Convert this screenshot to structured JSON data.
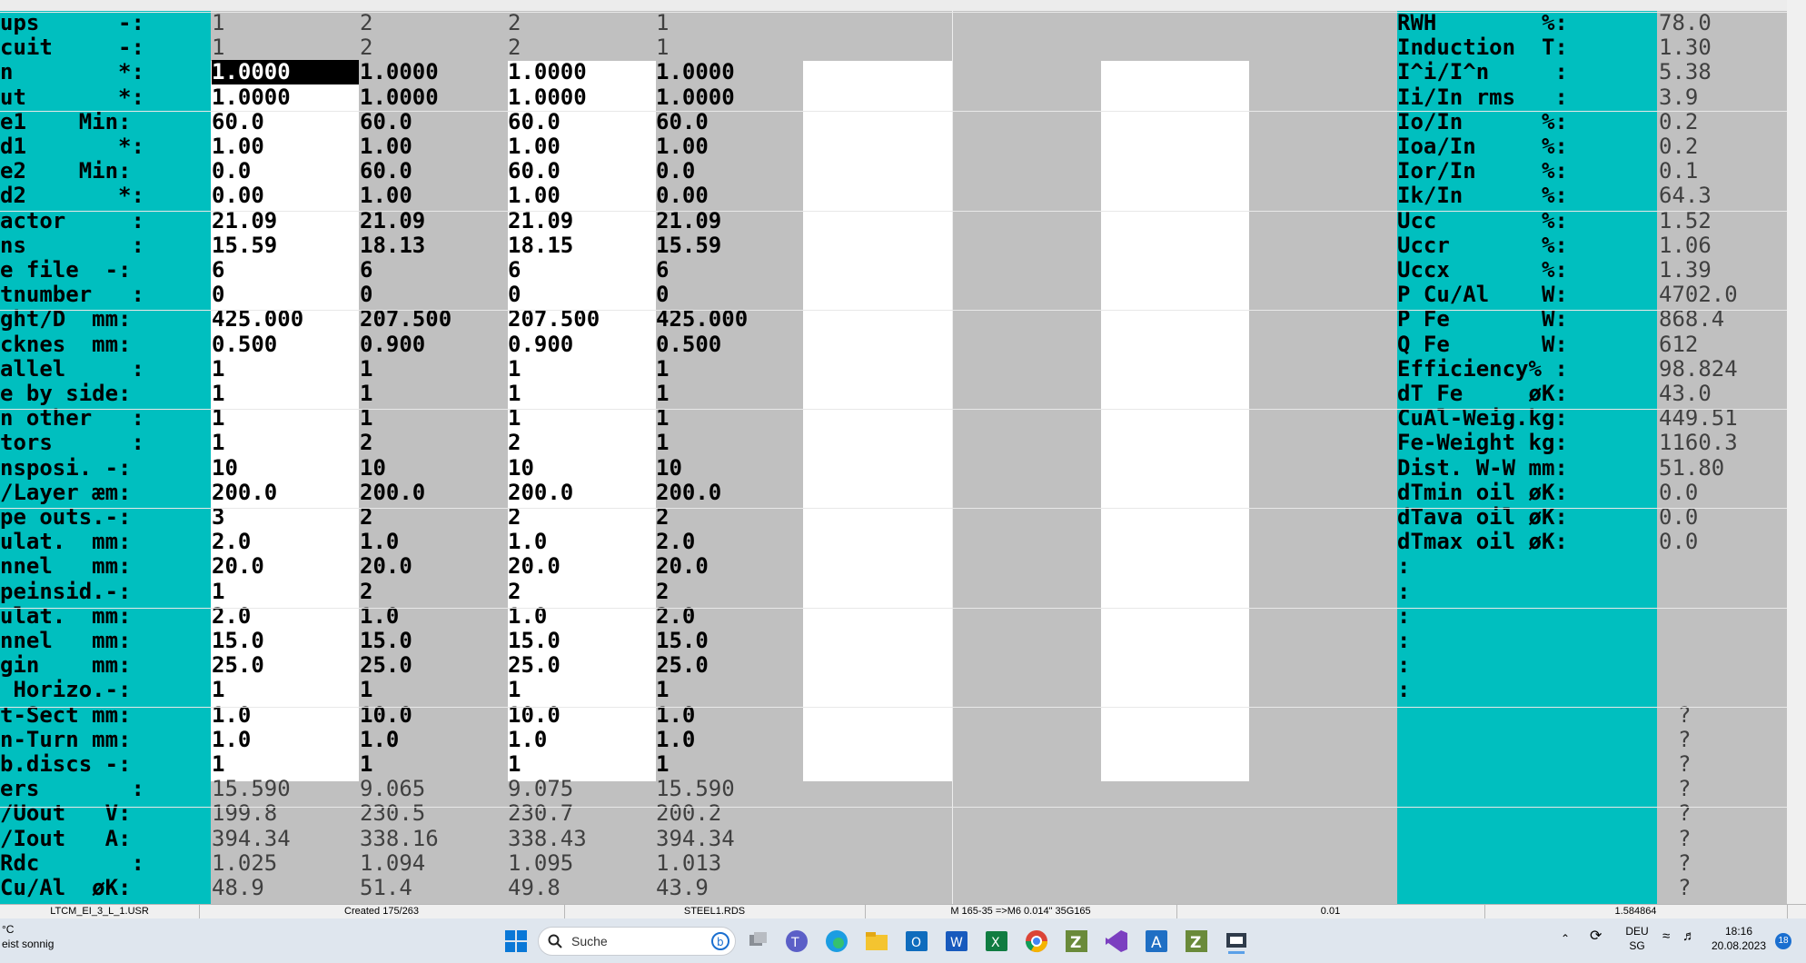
{
  "rows": [
    {
      "label": "ups      -:",
      "vals": [
        "1",
        "2",
        "2",
        "1"
      ],
      "style": "thin"
    },
    {
      "label": "cuit     -:",
      "vals": [
        "1",
        "2",
        "2",
        "1"
      ],
      "style": "thin"
    },
    {
      "label": "n        *:",
      "vals": [
        "1.0000",
        "1.0000",
        "1.0000",
        "1.0000"
      ],
      "style": "inp"
    },
    {
      "label": "ut       *:",
      "vals": [
        "1.0000",
        "1.0000",
        "1.0000",
        "1.0000"
      ],
      "style": "inp"
    },
    {
      "label": "e1    Min:",
      "vals": [
        "60.0",
        "60.0",
        "60.0",
        "60.0"
      ],
      "style": "inp"
    },
    {
      "label": "d1       *:",
      "vals": [
        "1.00",
        "1.00",
        "1.00",
        "1.00"
      ],
      "style": "inp"
    },
    {
      "label": "e2    Min:",
      "vals": [
        "0.0",
        "60.0",
        "60.0",
        "0.0"
      ],
      "style": "inp"
    },
    {
      "label": "d2       *:",
      "vals": [
        "0.00",
        "1.00",
        "1.00",
        "0.00"
      ],
      "style": "inp"
    },
    {
      "label": "actor     :",
      "vals": [
        "21.09",
        "21.09",
        "21.09",
        "21.09"
      ],
      "style": "inp"
    },
    {
      "label": "ns        :",
      "vals": [
        "15.59",
        "18.13",
        "18.15",
        "15.59"
      ],
      "style": "inp"
    },
    {
      "label": "e file  -:",
      "vals": [
        "6",
        "6",
        "6",
        "6"
      ],
      "style": "inp"
    },
    {
      "label": "tnumber   :",
      "vals": [
        "0",
        "0",
        "0",
        "0"
      ],
      "style": "inp"
    },
    {
      "label": "ght/D  mm:",
      "vals": [
        "425.000",
        "207.500",
        "207.500",
        "425.000"
      ],
      "style": "inp"
    },
    {
      "label": "cknes  mm:",
      "vals": [
        "0.500",
        "0.900",
        "0.900",
        "0.500"
      ],
      "style": "inp"
    },
    {
      "label": "allel     :",
      "vals": [
        "1",
        "1",
        "1",
        "1"
      ],
      "style": "inp"
    },
    {
      "label": "e by side:",
      "vals": [
        "1",
        "1",
        "1",
        "1"
      ],
      "style": "inp"
    },
    {
      "label": "n other   :",
      "vals": [
        "1",
        "1",
        "1",
        "1"
      ],
      "style": "inp"
    },
    {
      "label": "tors      :",
      "vals": [
        "1",
        "2",
        "2",
        "1"
      ],
      "style": "inp"
    },
    {
      "label": "nsposi. -:",
      "vals": [
        "10",
        "10",
        "10",
        "10"
      ],
      "style": "inp"
    },
    {
      "label": "/Layer æm:",
      "vals": [
        "200.0",
        "200.0",
        "200.0",
        "200.0"
      ],
      "style": "inp"
    },
    {
      "label": "pe outs.-:",
      "vals": [
        "3",
        "2",
        "2",
        "2"
      ],
      "style": "inp"
    },
    {
      "label": "ulat.  mm:",
      "vals": [
        "2.0",
        "1.0",
        "1.0",
        "2.0"
      ],
      "style": "inp"
    },
    {
      "label": "nnel   mm:",
      "vals": [
        "20.0",
        "20.0",
        "20.0",
        "20.0"
      ],
      "style": "inp"
    },
    {
      "label": "peinsid.-:",
      "vals": [
        "1",
        "2",
        "2",
        "2"
      ],
      "style": "inp"
    },
    {
      "label": "ulat.  mm:",
      "vals": [
        "2.0",
        "1.0",
        "1.0",
        "2.0"
      ],
      "style": "inp"
    },
    {
      "label": "nnel   mm:",
      "vals": [
        "15.0",
        "15.0",
        "15.0",
        "15.0"
      ],
      "style": "inp"
    },
    {
      "label": "gin    mm:",
      "vals": [
        "25.0",
        "25.0",
        "25.0",
        "25.0"
      ],
      "style": "inp"
    },
    {
      "label": " Horizo.-:",
      "vals": [
        "1",
        "1",
        "1",
        "1"
      ],
      "style": "inp"
    },
    {
      "label": "t-Sect mm:",
      "vals": [
        "1.0",
        "10.0",
        "10.0",
        "1.0"
      ],
      "style": "inp"
    },
    {
      "label": "n-Turn mm:",
      "vals": [
        "1.0",
        "1.0",
        "1.0",
        "1.0"
      ],
      "style": "inp"
    },
    {
      "label": "b.discs -:",
      "vals": [
        "1",
        "1",
        "1",
        "1"
      ],
      "style": "inp"
    },
    {
      "label": "ers       :",
      "vals": [
        "15.590",
        "9.065",
        "9.075",
        "15.590"
      ],
      "style": "thin"
    },
    {
      "label": "/Uout   V:",
      "vals": [
        "199.8",
        "230.5",
        "230.7",
        "200.2"
      ],
      "style": "thin"
    },
    {
      "label": "/Iout   A:",
      "vals": [
        "394.34",
        "338.16",
        "338.43",
        "394.34"
      ],
      "style": "thin"
    },
    {
      "label": "Rdc       :",
      "vals": [
        "1.025",
        "1.094",
        "1.095",
        "1.013"
      ],
      "style": "thin"
    },
    {
      "label": "Cu/Al  øK:",
      "vals": [
        "48.9",
        "51.4",
        "49.8",
        "43.9"
      ],
      "style": "thin"
    }
  ],
  "right_rows": [
    {
      "label": "RWH        %:",
      "value": "78.0"
    },
    {
      "label": "Induction  T:",
      "value": "1.30"
    },
    {
      "label": "I^i/I^n     :",
      "value": "5.38"
    },
    {
      "label": "Ii/In rms   :",
      "value": "3.9"
    },
    {
      "label": "Io/In      %:",
      "value": "0.2"
    },
    {
      "label": "Ioa/In     %:",
      "value": "0.2"
    },
    {
      "label": "Ior/In     %:",
      "value": "0.1"
    },
    {
      "label": "Ik/In      %:",
      "value": "64.3"
    },
    {
      "label": "Ucc        %:",
      "value": "1.52"
    },
    {
      "label": "Uccr       %:",
      "value": "1.06"
    },
    {
      "label": "Uccx       %:",
      "value": "1.39"
    },
    {
      "label": "P Cu/Al    W:",
      "value": "4702.0"
    },
    {
      "label": "P Fe       W:",
      "value": "868.4"
    },
    {
      "label": "Q Fe       W:",
      "value": "612"
    },
    {
      "label": "Efficiency% :",
      "value": "98.824"
    },
    {
      "label": "dT Fe     øK:",
      "value": "43.0"
    },
    {
      "label": "CuAl-Weig.kg:",
      "value": "449.51"
    },
    {
      "label": "Fe-Weight kg:",
      "value": "1160.3"
    },
    {
      "label": "Dist. W-W mm:",
      "value": "51.80"
    },
    {
      "label": "dTmin oil øK:",
      "value": "0.0"
    },
    {
      "label": "dTava oil øK:",
      "value": "0.0"
    },
    {
      "label": "dTmax oil øK:",
      "value": "0.0"
    },
    {
      "label": ":",
      "value": ""
    },
    {
      "label": ":",
      "value": ""
    },
    {
      "label": ":",
      "value": ""
    },
    {
      "label": ":",
      "value": ""
    },
    {
      "label": ":",
      "value": ""
    },
    {
      "label": ":",
      "value": ""
    },
    {
      "label": "",
      "value": "?"
    },
    {
      "label": "",
      "value": "?"
    },
    {
      "label": "",
      "value": "?"
    },
    {
      "label": "",
      "value": "?"
    },
    {
      "label": "",
      "value": "?"
    },
    {
      "label": "",
      "value": "?"
    },
    {
      "label": "",
      "value": "?"
    },
    {
      "label": "",
      "value": "?"
    }
  ],
  "statusbar": [
    "LTCM_EI_3_L_1.USR",
    "Created 175/263",
    "STEEL1.RDS",
    "M 165-35 =>M6 0.014\" 35G165",
    "0.01",
    "1.584864"
  ],
  "taskbar": {
    "weather_temp": "°C",
    "weather_text": "eist sonnig",
    "search_placeholder": "Suche",
    "lang": "DEU",
    "region": "SG",
    "time": "18:16",
    "date": "20.08.2023",
    "notifications": "18"
  },
  "icons": [
    "windows-start-icon",
    "search-icon",
    "bing-icon",
    "task-view-icon",
    "teams-icon",
    "edge-icon",
    "file-explorer-icon",
    "outlook-icon",
    "word-icon",
    "excel-icon",
    "chrome-icon",
    "z-app-icon",
    "visual-studio-icon",
    "a-app-icon",
    "z-app-icon",
    "active-app-icon"
  ]
}
